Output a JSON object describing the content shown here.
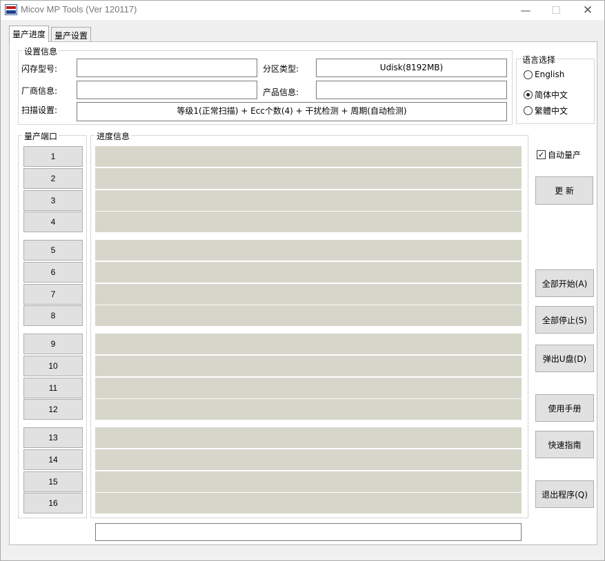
{
  "window": {
    "title": "Micov MP Tools (Ver 120117)",
    "min_glyph": "—",
    "max_glyph": "☐",
    "close_glyph": "✕"
  },
  "tabs": [
    {
      "label": "量产进度",
      "active": true
    },
    {
      "label": "量产设置",
      "active": false
    }
  ],
  "settings": {
    "legend": "设置信息",
    "flash_model_label": "闪存型号:",
    "flash_model_value": "",
    "partition_type_label": "分区类型:",
    "partition_type_value": "Udisk(8192MB)",
    "vendor_info_label": "厂商信息:",
    "vendor_info_value": "",
    "product_info_label": "产品信息:",
    "product_info_value": "",
    "scan_setting_label": "扫描设置:",
    "scan_setting_value": "等级1(正常扫描) + Ecc个数(4) + 干扰检测 + 周期(自动检测)"
  },
  "language": {
    "legend": "语言选择",
    "options": [
      {
        "label": "English",
        "selected": false
      },
      {
        "label": "简体中文",
        "selected": true
      },
      {
        "label": "繁體中文",
        "selected": false
      }
    ]
  },
  "ports": {
    "legend": "量产端口",
    "items": [
      "1",
      "2",
      "3",
      "4",
      "5",
      "6",
      "7",
      "8",
      "9",
      "10",
      "11",
      "12",
      "13",
      "14",
      "15",
      "16"
    ]
  },
  "progress": {
    "legend": "进度信息"
  },
  "auto_production": {
    "label": "自动量产",
    "checked": true,
    "check_glyph": "✓"
  },
  "buttons": {
    "refresh": "更 新",
    "start_all": "全部开始(A)",
    "stop_all": "全部停止(S)",
    "eject": "弹出U盘(D)",
    "manual": "使用手册",
    "quick_guide": "快速指南",
    "exit": "退出程序(Q)"
  },
  "status_text": ""
}
